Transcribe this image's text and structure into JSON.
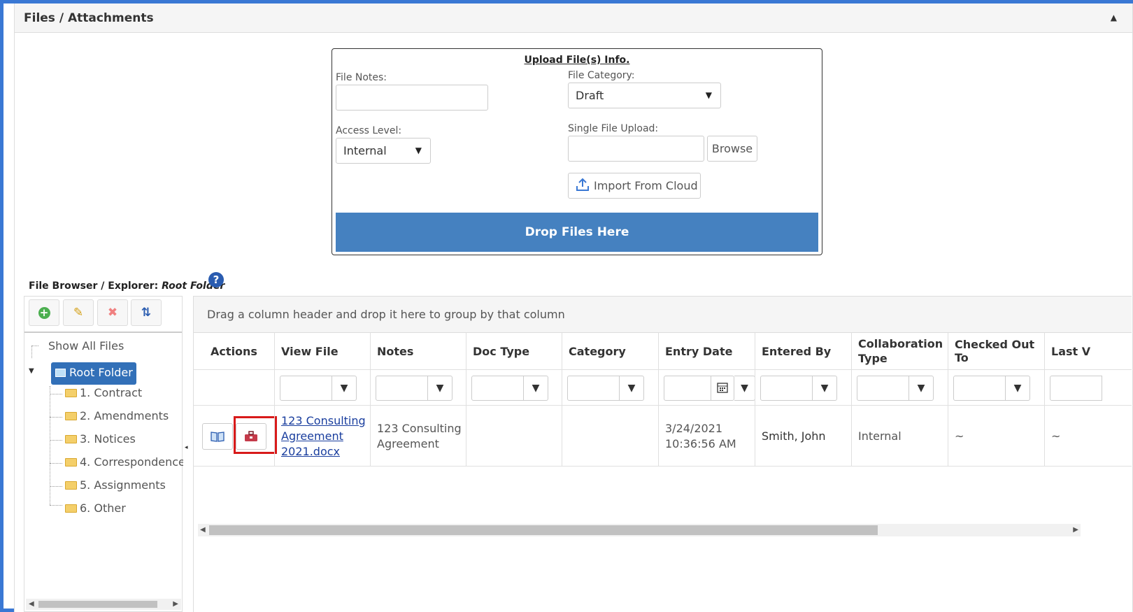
{
  "panel": {
    "title": "Files / Attachments",
    "collapse_glyph": "▲"
  },
  "upload": {
    "title": "Upload File(s) Info.",
    "file_notes_label": "File Notes:",
    "file_notes_value": "",
    "file_category_label": "File Category:",
    "file_category_value": "Draft",
    "access_level_label": "Access Level:",
    "access_level_value": "Internal",
    "single_upload_label": "Single File Upload:",
    "browse_label": "Browse",
    "import_cloud_label": "Import From Cloud",
    "drop_zone_label": "Drop Files Here",
    "arrow_glyph": "▼"
  },
  "file_browser": {
    "title_prefix": "File Browser / Explorer:",
    "current_folder": "Root Folder",
    "help_glyph": "?",
    "toolbar": {
      "add_glyph": "+",
      "edit_glyph": "✎",
      "delete_glyph": "✖",
      "sort_glyph": "⇅"
    },
    "show_all": "Show All Files",
    "root_label": "Root Folder",
    "folders": [
      "1. Contract",
      "2. Amendments",
      "3. Notices",
      "4. Correspondence",
      "5. Assignments",
      "6. Other"
    ],
    "collapse_glyph": "◂"
  },
  "grid": {
    "group_hint": "Drag a column header and drop it here to group by that column",
    "columns": [
      "Actions",
      "View File",
      "Notes",
      "Doc Type",
      "Category",
      "Entry Date",
      "Entered By",
      "Collaboration Type",
      "Checked Out To",
      "Last V"
    ],
    "filter_glyph": "▼",
    "row": {
      "view_file": "123 Consulting Agreement 2021.docx",
      "notes": "123 Consulting Agreement",
      "doc_type": "",
      "category": "",
      "entry_date": "3/24/2021 10:36:56 AM",
      "entered_by": "Smith, John",
      "collaboration_type": "Internal",
      "checked_out_to": "~",
      "last_v": "~"
    }
  },
  "colors": {
    "frame": "#3a78d4",
    "drop_zone": "#4581c0",
    "selected_folder": "#3270b8",
    "highlight": "#d81a1a"
  }
}
